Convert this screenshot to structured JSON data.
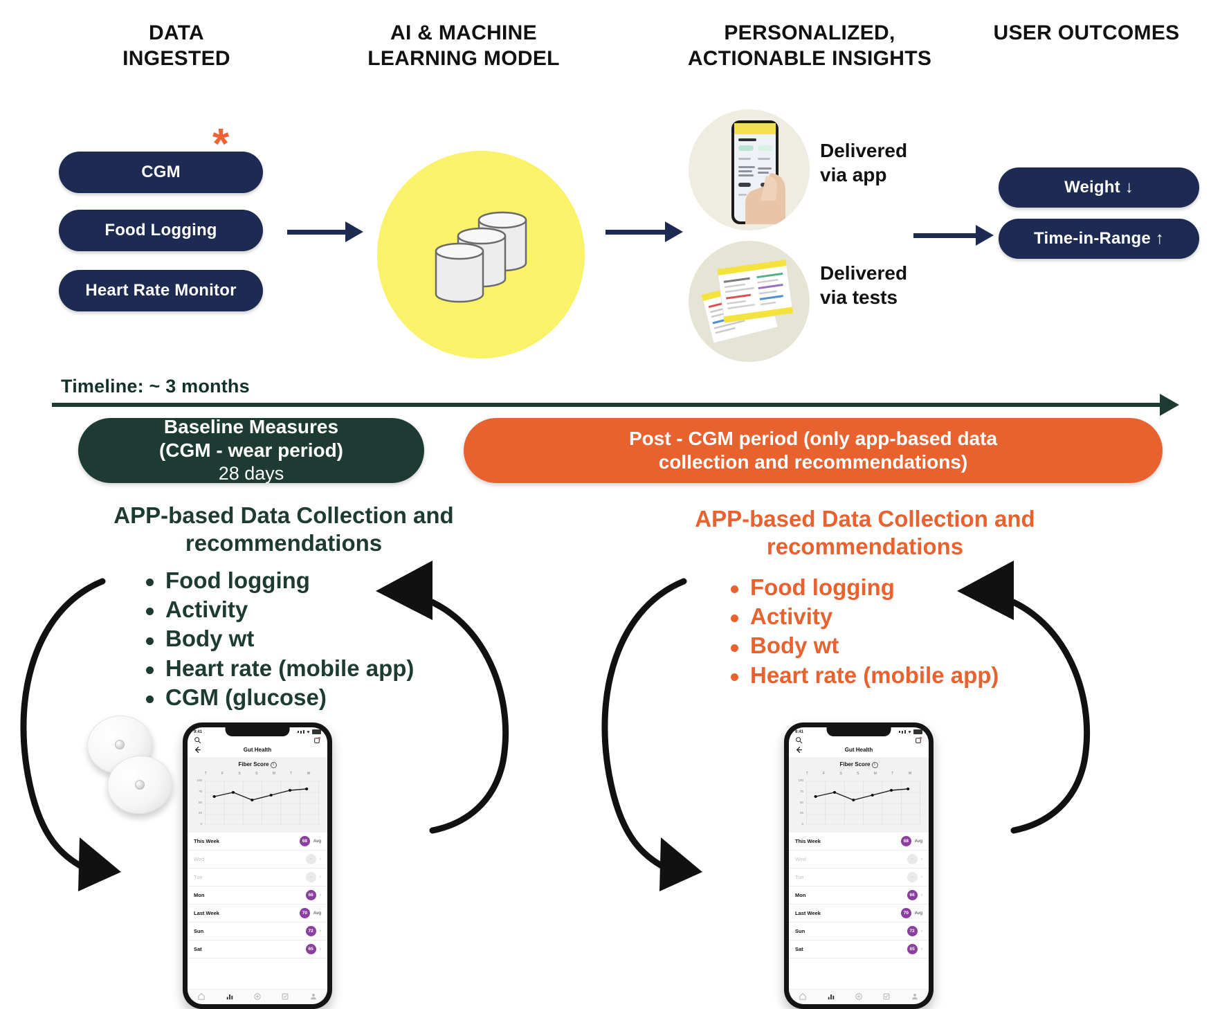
{
  "columns": [
    {
      "id": "data-ingested",
      "title": "DATA\nINGESTED"
    },
    {
      "id": "ai-model",
      "title": "AI & MACHINE\nLEARNING MODEL"
    },
    {
      "id": "insights",
      "title": "PERSONALIZED,\nACTIONABLE INSIGHTS"
    },
    {
      "id": "outcomes",
      "title": "USER OUTCOMES"
    }
  ],
  "inputs": {
    "pills": [
      {
        "label": "CGM",
        "marker": "*"
      },
      {
        "label": "Food Logging",
        "marker": ""
      },
      {
        "label": "Heart Rate Monitor",
        "marker": ""
      }
    ]
  },
  "model": {
    "icon": "database-stack-icon",
    "circle_color": "#faf268"
  },
  "insights": {
    "items": [
      {
        "icon": "hand-holding-phone-photo",
        "label": "Delivered\nvia app"
      },
      {
        "icon": "lab-test-reports-photo",
        "label": "Delivered\nvia tests"
      }
    ]
  },
  "outcomes": {
    "pills": [
      {
        "label": "Weight ↓"
      },
      {
        "label": "Time-in-Range ↑"
      }
    ]
  },
  "timeline": {
    "label": "Timeline: ~ 3 months",
    "phases": [
      {
        "id": "baseline",
        "line1": "Baseline Measures",
        "line2": "(CGM - wear period)",
        "line3": "28 days",
        "color": "#1d3b33"
      },
      {
        "id": "post-cgm",
        "line1": "Post - CGM period (only app-based data",
        "line2": "collection and recommendations)",
        "line3": "",
        "color": "#e8622f"
      }
    ]
  },
  "panels": [
    {
      "id": "baseline-panel",
      "title": "APP-based Data Collection and\nrecommendations",
      "color": "#1d3b33",
      "bullets": [
        "Food logging",
        "Activity",
        "Body wt",
        "Heart rate (mobile app)",
        "CGM (glucose)"
      ],
      "has_sensors": true
    },
    {
      "id": "post-cgm-panel",
      "title": "APP-based Data Collection and\nrecommendations",
      "color": "#e8622f",
      "bullets": [
        "Food logging",
        "Activity",
        "Body wt",
        "Heart rate (mobile app)"
      ],
      "has_sensors": false
    }
  ],
  "phone": {
    "status_time": "9:41",
    "screen_title": "Gut Health",
    "card_title": "Fiber Score",
    "day_labels": [
      "T",
      "F",
      "S",
      "S",
      "M",
      "T",
      "W"
    ],
    "y_labels": [
      "100",
      "75",
      "50",
      "25",
      "0"
    ],
    "rows": [
      {
        "label": "This Week",
        "badge": "68",
        "badge_state": "filled",
        "meta": "Avg",
        "chevron": false
      },
      {
        "label": "Wed",
        "badge": "-",
        "badge_state": "empty",
        "meta": "",
        "chevron": true
      },
      {
        "label": "Tue",
        "badge": "-",
        "badge_state": "empty",
        "meta": "",
        "chevron": true
      },
      {
        "label": "Mon",
        "badge": "66",
        "badge_state": "filled",
        "meta": "",
        "chevron": true
      },
      {
        "label": "Last Week",
        "badge": "70",
        "badge_state": "filled",
        "meta": "Avg",
        "chevron": false
      },
      {
        "label": "Sun",
        "badge": "72",
        "badge_state": "filled",
        "meta": "",
        "chevron": true
      },
      {
        "label": "Sat",
        "badge": "65",
        "badge_state": "filled",
        "meta": "",
        "chevron": true
      }
    ],
    "tabs": [
      "home-icon",
      "chart-icon",
      "plus-circle-icon",
      "checkbox-icon",
      "person-icon"
    ]
  },
  "chart_data": {
    "type": "line",
    "title": "Fiber Score",
    "x": [
      "T",
      "F",
      "S",
      "S",
      "M",
      "T",
      "W"
    ],
    "values": [
      62,
      70,
      55,
      64,
      72,
      74,
      null
    ],
    "ylim": [
      0,
      100
    ],
    "ylabel": "",
    "xlabel": "",
    "grid": true,
    "legend": "none"
  },
  "colors": {
    "navy": "#1d2a51",
    "green": "#1d3b33",
    "orange": "#e8622f",
    "yellow": "#faf268",
    "badge_purple": "#8a3fa0"
  }
}
